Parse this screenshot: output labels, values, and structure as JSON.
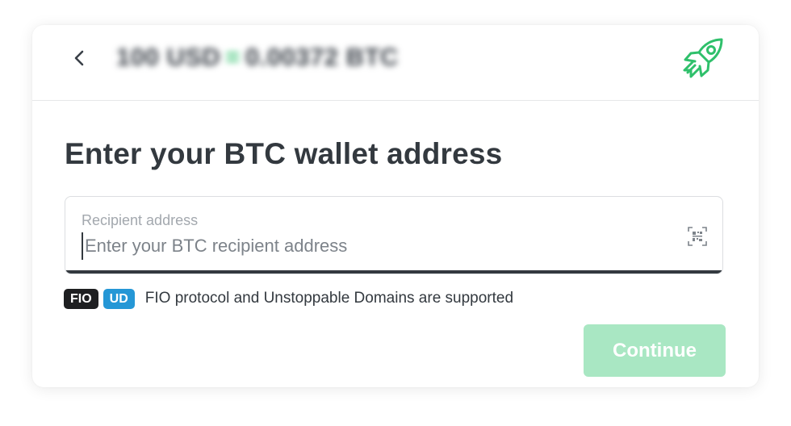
{
  "header": {
    "amount_from": "100 USD",
    "equals": "=",
    "amount_to": "0.00372 BTC",
    "back_icon": "chevron-left-icon",
    "logo_icon": "rocket-icon"
  },
  "main": {
    "title": "Enter your BTC wallet address",
    "address_field": {
      "label": "Recipient address",
      "placeholder": "Enter your BTC recipient address",
      "value": "",
      "scan_icon": "qr-scan-icon"
    },
    "support": {
      "badges": [
        "FIO",
        "UD"
      ],
      "text": "FIO protocol and Unstoppable Domains are supported"
    },
    "continue_label": "Continue"
  },
  "colors": {
    "accent": "#2fc06b",
    "button_disabled": "#a9e7c3",
    "text_dark": "#33393f",
    "badge_fio": "#1e1f21",
    "badge_ud": "#2597d6"
  }
}
